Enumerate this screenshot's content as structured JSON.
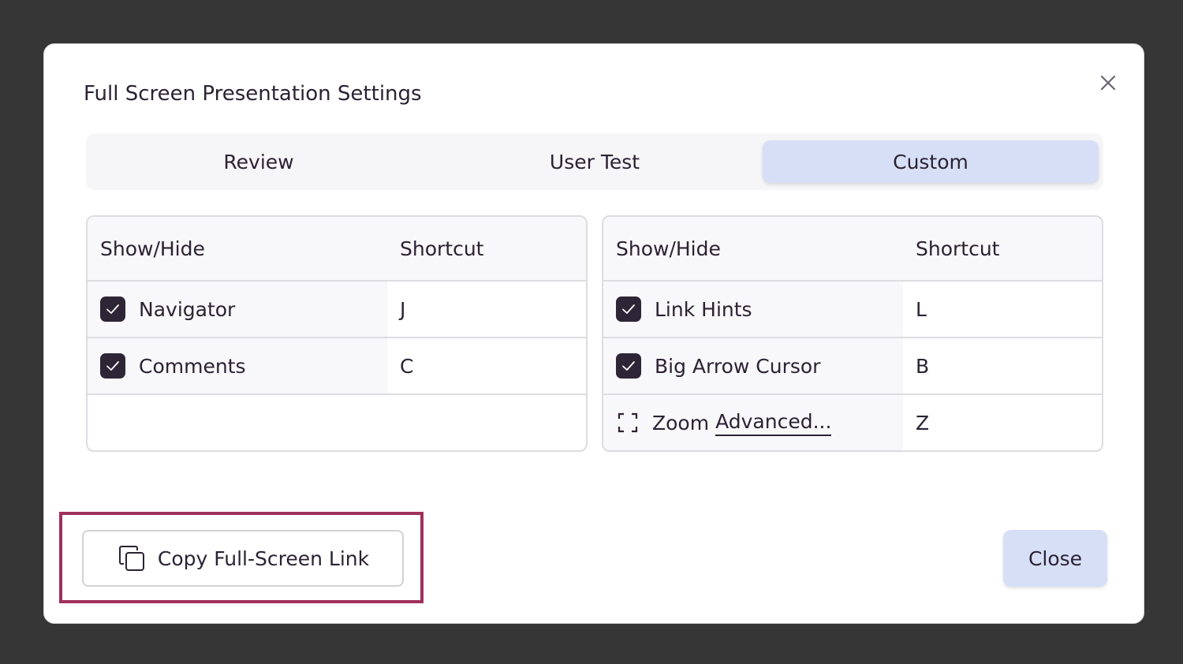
{
  "dialog": {
    "title": "Full Screen Presentation Settings",
    "close_icon": "close-icon"
  },
  "tabs": [
    {
      "label": "Review",
      "active": false
    },
    {
      "label": "User Test",
      "active": false
    },
    {
      "label": "Custom",
      "active": true
    }
  ],
  "left_table": {
    "headers": [
      "Show/Hide",
      "Shortcut"
    ],
    "rows": [
      {
        "label": "Navigator",
        "checked": true,
        "shortcut": "J"
      },
      {
        "label": "Comments",
        "checked": true,
        "shortcut": "C"
      }
    ]
  },
  "right_table": {
    "headers": [
      "Show/Hide",
      "Shortcut"
    ],
    "rows": [
      {
        "label": "Link Hints",
        "checked": true,
        "shortcut": "L"
      },
      {
        "label": "Big Arrow Cursor",
        "checked": true,
        "shortcut": "B"
      },
      {
        "label": "Zoom",
        "link": "Advanced...",
        "icon": "zoom-frame-icon",
        "shortcut": "Z"
      }
    ]
  },
  "footer": {
    "copy_link_label": "Copy Full-Screen Link",
    "copy_icon": "copy-icon",
    "close_label": "Close"
  },
  "colors": {
    "backdrop": "#363636",
    "accent": "#d6dff6",
    "checkbox": "#2e2536",
    "highlight": "#a0305c",
    "text": "#2b2233"
  }
}
